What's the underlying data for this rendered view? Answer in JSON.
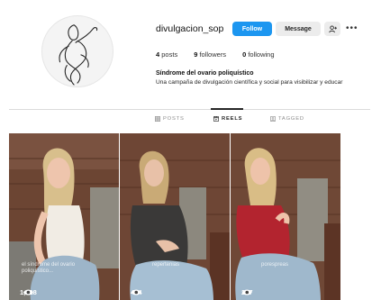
{
  "profile": {
    "username": "divulgacion_sop",
    "follow_label": "Follow",
    "message_label": "Message",
    "suggest_icon": "add-person-icon",
    "more_label": "•••",
    "posts_count": "4",
    "posts_label": "posts",
    "followers_count": "9",
    "followers_label": "followers",
    "following_count": "0",
    "following_label": "following",
    "bio_name": "Síndrome del ovario poliquístico",
    "bio_text": "Una campaña de divulgación científica y social para visibilizar y educar"
  },
  "tabs": [
    {
      "label": "POSTS",
      "icon": "grid-icon",
      "active": false
    },
    {
      "label": "REELS",
      "icon": "reels-icon",
      "active": true
    },
    {
      "label": "TAGGED",
      "icon": "tag-icon",
      "active": false
    }
  ],
  "reels": [
    {
      "caption_line1": "el síndrome del ovario",
      "caption_line2": "poliquístico...",
      "views": "1,228"
    },
    {
      "caption_line1": "repertenias",
      "caption_line2": "",
      "views": "464"
    },
    {
      "caption_line1": "porespreas",
      "caption_line2": "",
      "views": "207"
    }
  ],
  "colors": {
    "accent": "#1c96f0",
    "button_bg": "#ececec",
    "text": "#262626"
  }
}
